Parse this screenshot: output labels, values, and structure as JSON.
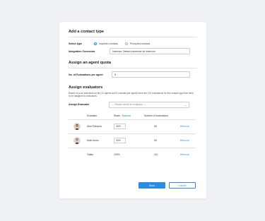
{
  "contact_type": {
    "title": "Add a contact type",
    "select_type_label": "Select type",
    "options": [
      {
        "label": "Imported contacts",
        "selected": true
      },
      {
        "label": "Prompted contacts",
        "selected": false
      }
    ],
    "integration_label": "Integration Connector",
    "integration_value": "Intercom: Default connector for Intercom"
  },
  "quota": {
    "title": "Assign an agent quota",
    "evals_label": "No. of Evaluations per agent",
    "evals_value": "5"
  },
  "evaluators": {
    "title": "Assign evaluators",
    "description": "Based on your selections so far (12 agents and 5 contacts per agent) there are 110 evaluations for this contact type that need to be assigned to evaluators.",
    "assign_label": "Assign Evaluator",
    "assign_placeholder": "--- Please select an evaluator ---",
    "table": {
      "col_evaluator": "Evaluator",
      "col_share": "Share - ",
      "col_share_link": "Balance",
      "col_count": "Number of evaluations",
      "rows": [
        {
          "name": "Alex Richards",
          "share": "50%",
          "count": "55",
          "action": "Remove"
        },
        {
          "name": "Matt Jones",
          "share": "50%",
          "count": "55",
          "action": "Remove"
        }
      ],
      "totals": {
        "label": "Totals",
        "share": "100%",
        "count": "110",
        "action": "Remove"
      }
    }
  },
  "buttons": {
    "save": "Save",
    "cancel": "Cancel"
  },
  "colors": {
    "accent": "#2b8ce3",
    "background": "#eef1f5",
    "card": "#ffffff"
  }
}
